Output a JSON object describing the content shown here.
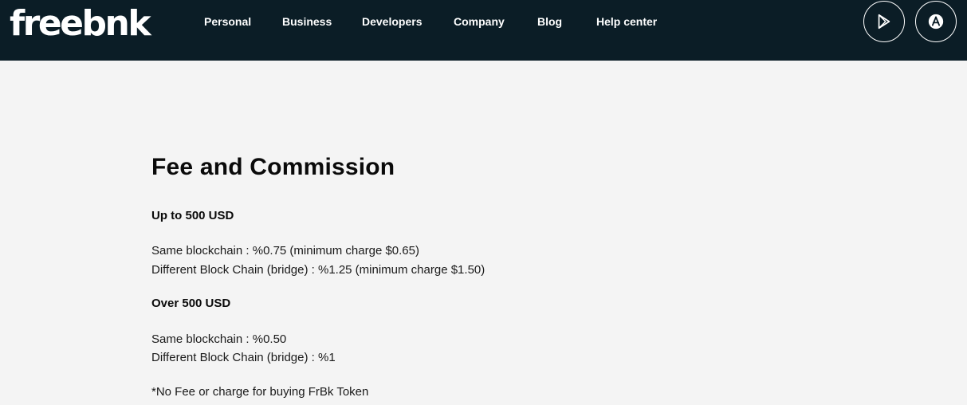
{
  "header": {
    "logo_text": "freebnk",
    "nav": [
      {
        "label": "Personal"
      },
      {
        "label": "Business"
      },
      {
        "label": "Developers"
      },
      {
        "label": "Company"
      },
      {
        "label": "Blog"
      },
      {
        "label": "Help center"
      }
    ],
    "store_buttons": [
      {
        "icon": "google-play-icon"
      },
      {
        "icon": "app-store-icon"
      }
    ]
  },
  "main": {
    "title": "Fee and Commission",
    "tiers": [
      {
        "heading": "Up to 500 USD",
        "lines": [
          "Same blockchain : %0.75 (minimum charge $0.65)",
          "Different Block Chain (bridge) : %1.25 (minimum charge $1.50)"
        ]
      },
      {
        "heading": "Over 500 USD",
        "lines": [
          "Same blockchain : %0.50",
          "Different Block Chain (bridge) : %1"
        ]
      }
    ],
    "note": "*No Fee or charge for buying FrBk Token"
  },
  "colors": {
    "header_bg": "#0b1d26",
    "page_bg": "#f4f4f4",
    "text": "#111111"
  }
}
